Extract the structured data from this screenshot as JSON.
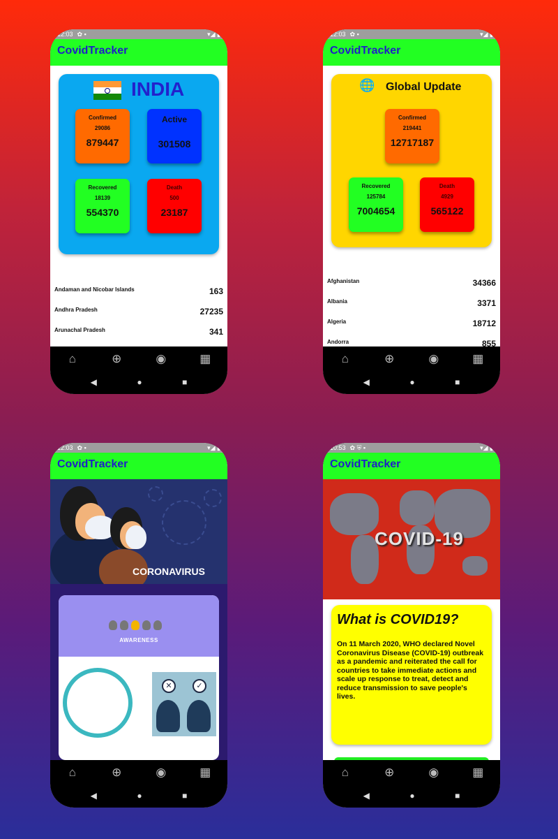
{
  "app_title": "CovidTracker",
  "phones": {
    "india": {
      "time": "12:03",
      "title": "INDIA",
      "confirmed": {
        "label": "Confirmed",
        "new": "29086",
        "total": "879447"
      },
      "active": {
        "label": "Active",
        "total": "301508"
      },
      "recovered": {
        "label": "Recovered",
        "new": "18139",
        "total": "554370"
      },
      "death": {
        "label": "Death",
        "new": "500",
        "total": "23187"
      },
      "states": [
        {
          "name": "Andaman and Nicobar Islands",
          "value": "163"
        },
        {
          "name": "Andhra Pradesh",
          "value": "27235"
        },
        {
          "name": "Arunachal Pradesh",
          "value": "341"
        }
      ]
    },
    "global": {
      "time": "12:03",
      "title": "Global Update",
      "confirmed": {
        "label": "Confirmed",
        "new": "219441",
        "total": "12717187"
      },
      "recovered": {
        "label": "Recovered",
        "new": "125784",
        "total": "7004654"
      },
      "death": {
        "label": "Death",
        "new": "4929",
        "total": "565122"
      },
      "countries": [
        {
          "name": "Afghanistan",
          "value": "34366"
        },
        {
          "name": "Albania",
          "value": "3371"
        },
        {
          "name": "Algeria",
          "value": "18712"
        },
        {
          "name": "Andorra",
          "value": "855"
        }
      ]
    },
    "awareness": {
      "time": "12:03",
      "banner_text": "CORONAVIRUS",
      "card_text": "AWARENESS"
    },
    "info": {
      "time": "10:53",
      "banner_text": "COVID-19",
      "heading": "What is COVID19?",
      "body": "On 11 March 2020, WHO declared Novel Coronavirus Disease (COVID-19) outbreak as a pandemic and reiterated the call for countries to take immediate actions and scale up response to treat, detect and reduce transmission to save people's lives."
    }
  },
  "nav": {
    "icons": [
      "home-icon",
      "globe-icon",
      "nfc-icon",
      "dashboard-icon"
    ]
  },
  "colors": {
    "appbar": "#22ff22",
    "title": "#1e1ec8",
    "confirmed": "#ff6a00",
    "active": "#0032ff",
    "recovered": "#22ff22",
    "death": "#ff0000",
    "india_card": "#0aa8f0",
    "global_card": "#ffd600",
    "info_card": "#ffff00"
  }
}
